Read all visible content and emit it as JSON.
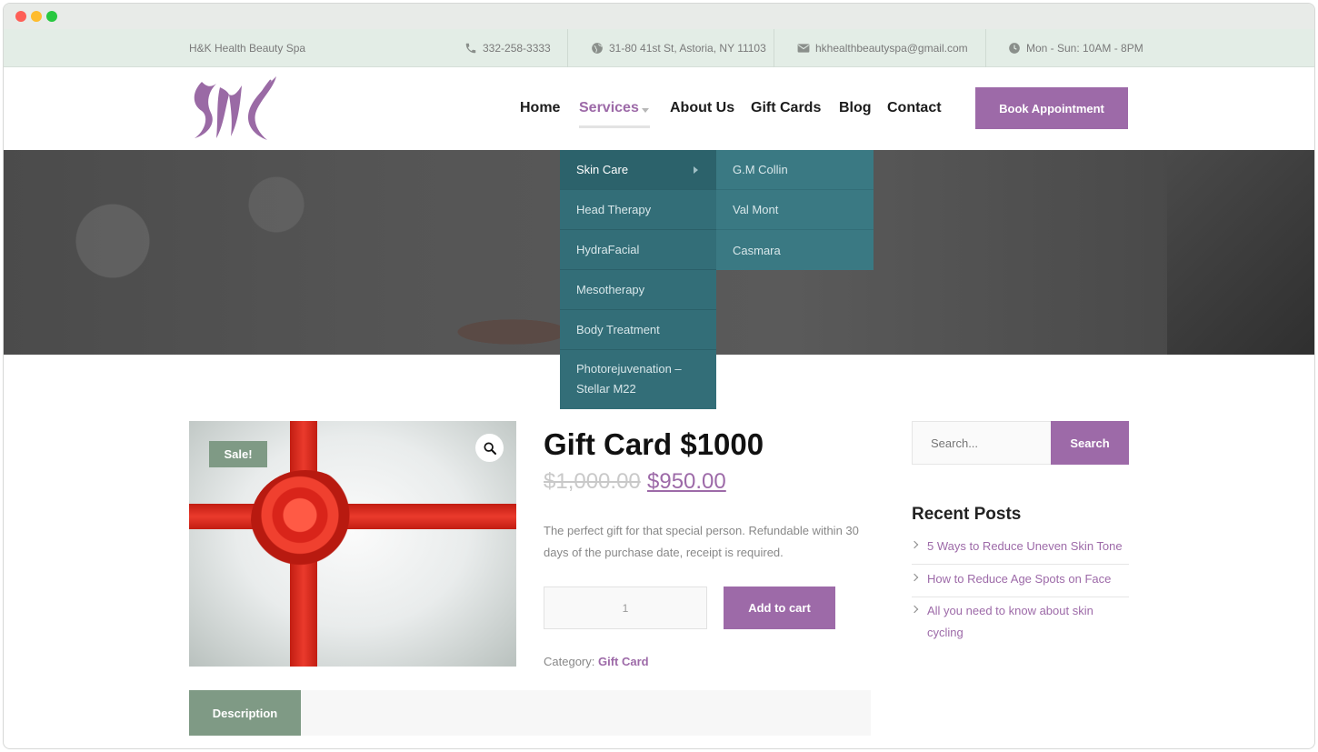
{
  "topbar": {
    "brand": "H&K Health Beauty Spa",
    "phone": "332-258-3333",
    "address": "31-80 41st St, Astoria, NY 11103",
    "email": "hkhealthbeautyspa@gmail.com",
    "hours": "Mon - Sun: 10AM - 8PM"
  },
  "nav": {
    "items": [
      {
        "label": "Home"
      },
      {
        "label": "Services"
      },
      {
        "label": "About Us"
      },
      {
        "label": "Gift Cards"
      },
      {
        "label": "Blog"
      },
      {
        "label": "Contact"
      }
    ],
    "cta": "Book Appointment"
  },
  "services_menu": {
    "items": [
      "Skin Care",
      "Head Therapy",
      "HydraFacial",
      "Mesotherapy",
      "Body Treatment",
      "Photorejuvenation –",
      "Stellar M22"
    ],
    "submenu": [
      "G.M Collin",
      "Val Mont",
      "Casmara"
    ]
  },
  "product": {
    "sale_badge": "Sale!",
    "title": "Gift Card $1000",
    "old_price": "$1,000.00",
    "new_price": "$950.00",
    "description": "The perfect gift for that special person. Refundable within 30 days of the purchase date, receipt is required.",
    "quantity": "1",
    "add_to_cart": "Add to cart",
    "category_label": "Category:",
    "category_value": "Gift Card",
    "tab_description": "Description"
  },
  "sidebar": {
    "search_placeholder": "Search...",
    "search_button": "Search",
    "recent_posts_title": "Recent Posts",
    "posts": [
      "5 Ways to Reduce Uneven Skin Tone",
      "How to Reduce Age Spots on Face",
      "All you need to know about skin cycling"
    ]
  },
  "colors": {
    "accent": "#9d6aa8",
    "sage": "#7f9a85",
    "dropdown": "#336e78"
  }
}
